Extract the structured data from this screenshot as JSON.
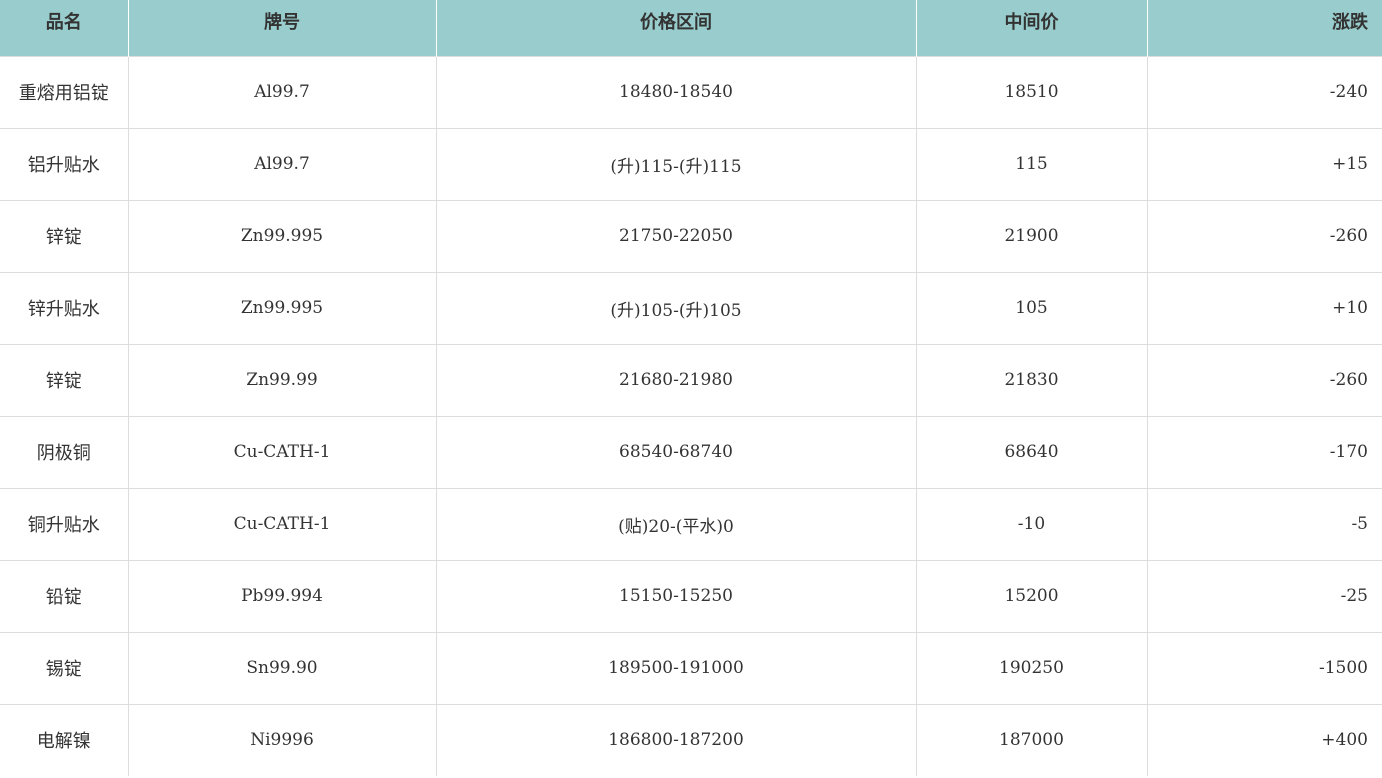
{
  "table": {
    "headers": {
      "name": "品名",
      "grade": "牌号",
      "range": "价格区间",
      "mid": "中间价",
      "change": "涨跌"
    },
    "rows": [
      {
        "name": "重熔用铝锭",
        "grade": "Al99.7",
        "range": "18480-18540",
        "mid": "18510",
        "change": "-240"
      },
      {
        "name": "铝升贴水",
        "grade": "Al99.7",
        "range": "(升)115-(升)115",
        "mid": "115",
        "change": "+15"
      },
      {
        "name": "锌锭",
        "grade": "Zn99.995",
        "range": "21750-22050",
        "mid": "21900",
        "change": "-260"
      },
      {
        "name": "锌升贴水",
        "grade": "Zn99.995",
        "range": "(升)105-(升)105",
        "mid": "105",
        "change": "+10"
      },
      {
        "name": "锌锭",
        "grade": "Zn99.99",
        "range": "21680-21980",
        "mid": "21830",
        "change": "-260"
      },
      {
        "name": "阴极铜",
        "grade": "Cu-CATH-1",
        "range": "68540-68740",
        "mid": "68640",
        "change": "-170"
      },
      {
        "name": "铜升贴水",
        "grade": "Cu-CATH-1",
        "range": "(贴)20-(平水)0",
        "mid": "-10",
        "change": "-5"
      },
      {
        "name": "铅锭",
        "grade": "Pb99.994",
        "range": "15150-15250",
        "mid": "15200",
        "change": "-25"
      },
      {
        "name": "锡锭",
        "grade": "Sn99.90",
        "range": "189500-191000",
        "mid": "190250",
        "change": "-1500"
      },
      {
        "name": "电解镍",
        "grade": "Ni9996",
        "range": "186800-187200",
        "mid": "187000",
        "change": "+400"
      }
    ]
  },
  "colors": {
    "header_bg": "#99cccc",
    "text": "#333333",
    "border": "#dddddd"
  }
}
